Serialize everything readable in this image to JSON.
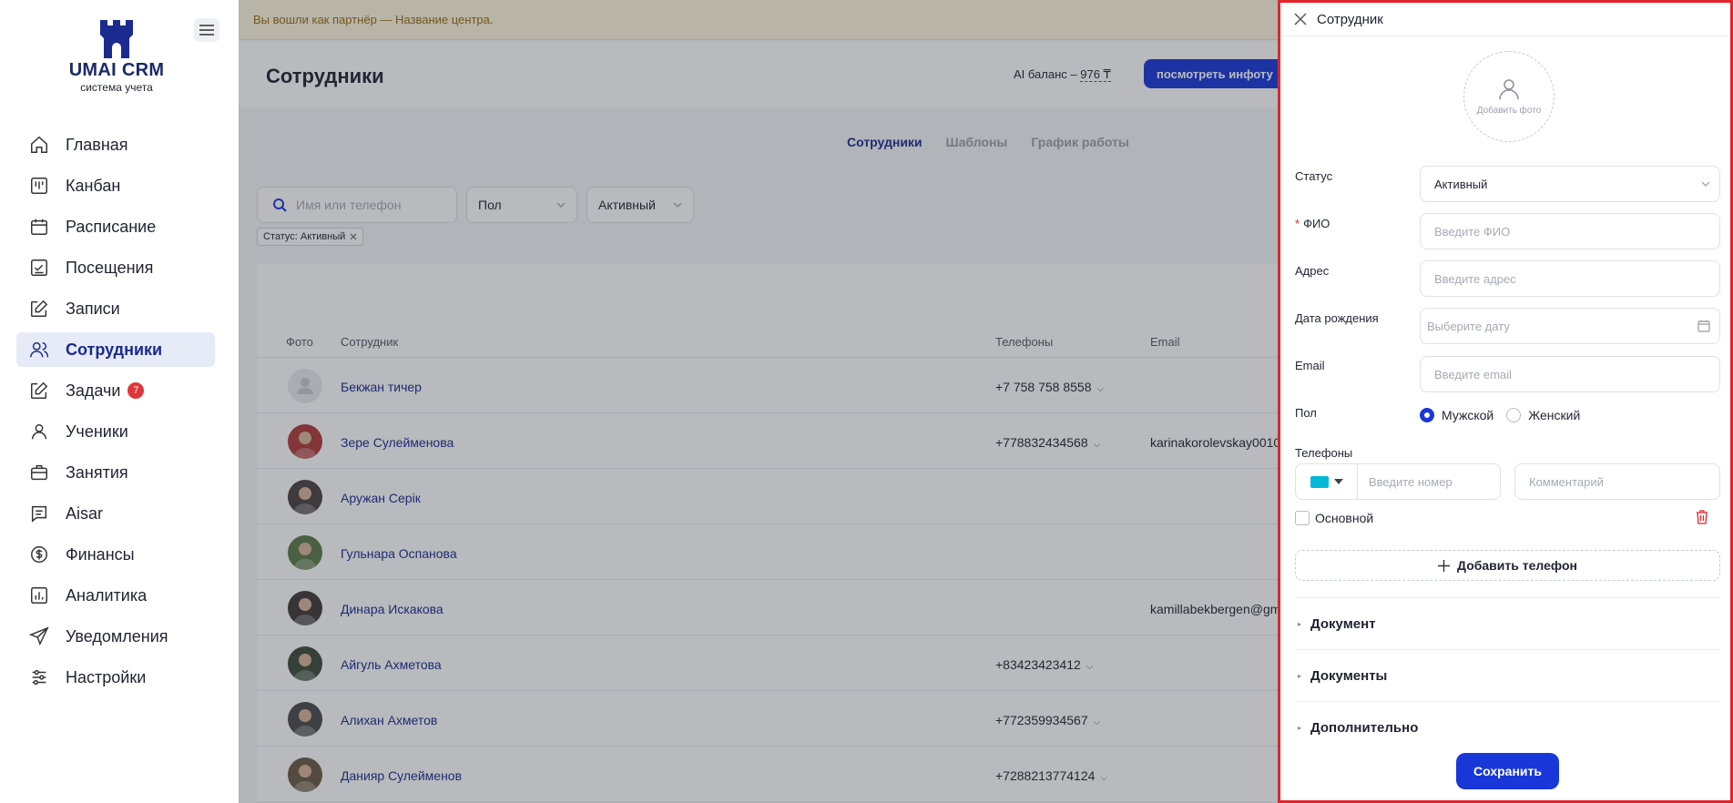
{
  "brand": {
    "title": "UMAI CRM",
    "subtitle": "система учета"
  },
  "sidebar": {
    "items": [
      {
        "label": "Главная",
        "icon": "home-icon"
      },
      {
        "label": "Канбан",
        "icon": "kanban-icon"
      },
      {
        "label": "Расписание",
        "icon": "calendar-icon"
      },
      {
        "label": "Посещения",
        "icon": "attendance-icon"
      },
      {
        "label": "Записи",
        "icon": "edit-icon"
      },
      {
        "label": "Сотрудники",
        "icon": "users-icon",
        "active": true
      },
      {
        "label": "Задачи",
        "icon": "tasks-icon",
        "badge": "7"
      },
      {
        "label": "Ученики",
        "icon": "user-icon"
      },
      {
        "label": "Занятия",
        "icon": "briefcase-icon"
      },
      {
        "label": "Aisar",
        "icon": "chat-icon"
      },
      {
        "label": "Финансы",
        "icon": "dollar-icon"
      },
      {
        "label": "Аналитика",
        "icon": "chart-icon"
      },
      {
        "label": "Уведомления",
        "icon": "send-icon"
      },
      {
        "label": "Настройки",
        "icon": "sliders-icon"
      }
    ]
  },
  "banner": {
    "text": "Вы вошли как партнёр — Название центра."
  },
  "header": {
    "title": "Сотрудники",
    "ai_balance_label": "AI баланс –",
    "ai_balance_value": "976 ₸",
    "info_button": "посмотреть инфоту"
  },
  "tabs": [
    "Сотрудники",
    "Шаблоны",
    "График работы"
  ],
  "filters": {
    "search_placeholder": "Имя или телефон",
    "gender": "Пол",
    "status": "Активный",
    "chip": "Статус: Активный"
  },
  "table": {
    "columns": {
      "photo": "Фото",
      "employee": "Сотрудник",
      "phones": "Телефоны",
      "email": "Email"
    },
    "rows": [
      {
        "name": "Бекжан тичер",
        "phone": "+7 758 758 8558",
        "email": "",
        "avatar_color": "#e9ebef"
      },
      {
        "name": "Зере Сулейменова",
        "phone": "+778832434568",
        "email": "karinakorolevskay0010",
        "avatar_color": "#b03a3a"
      },
      {
        "name": "Аружан Серік",
        "phone": "",
        "email": "",
        "avatar_color": "#4a4040"
      },
      {
        "name": "Гульнара Оспанова",
        "phone": "",
        "email": "",
        "avatar_color": "#5b7a4a"
      },
      {
        "name": "Динара Искакова",
        "phone": "",
        "email": "kamillabekbergen@gm",
        "avatar_color": "#3f3a3a"
      },
      {
        "name": "Айгуль Ахметова",
        "phone": "+83423423412",
        "email": "",
        "avatar_color": "#3d4a3a"
      },
      {
        "name": "Алихан Ахметов",
        "phone": "+772359934567",
        "email": "",
        "avatar_color": "#4a4a4a"
      },
      {
        "name": "Данияр Сулейменов",
        "phone": "+7288213774124",
        "email": "",
        "avatar_color": "#6b5a45"
      }
    ]
  },
  "drawer": {
    "title": "Сотрудник",
    "photo_label": "Добавить фото",
    "fields": {
      "status_label": "Статус",
      "status_value": "Активный",
      "fio_label": "ФИО",
      "fio_placeholder": "Введите ФИО",
      "address_label": "Адрес",
      "address_placeholder": "Введите адрес",
      "birth_label": "Дата рождения",
      "birth_placeholder": "Выберите дату",
      "email_label": "Email",
      "email_placeholder": "Введите email",
      "gender_label": "Пол",
      "gender_male": "Мужской",
      "gender_female": "Женский",
      "phones_label": "Телефоны",
      "phone_placeholder": "Введите номер",
      "comment_placeholder": "Комментарий",
      "main_label": "Основной",
      "add_phone": "Добавить телефон"
    },
    "sections": [
      "Документ",
      "Документы",
      "Дополнительно"
    ],
    "save": "Сохранить"
  },
  "colors": {
    "primary": "#1937d9",
    "accent_red": "#e0262b",
    "link": "#1b2a8f"
  }
}
